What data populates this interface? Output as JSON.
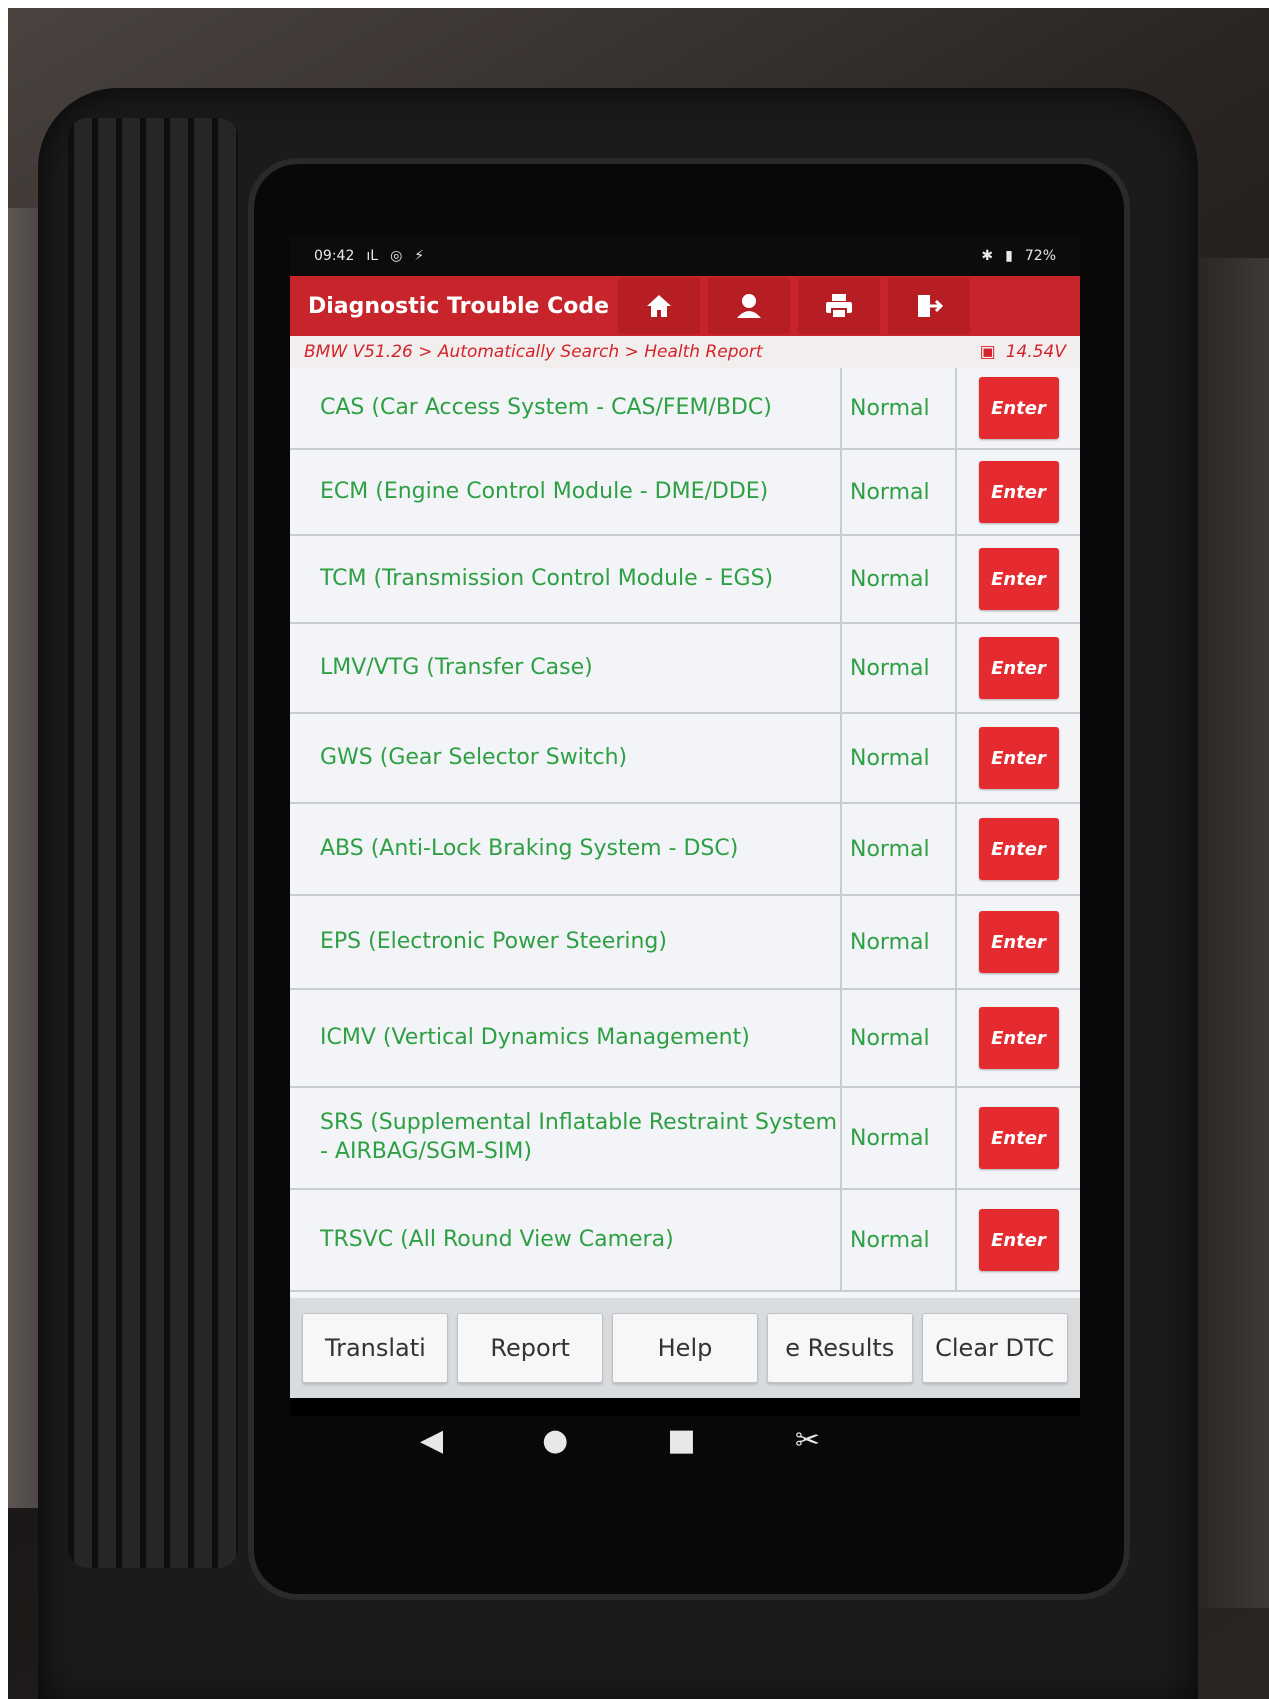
{
  "status_bar": {
    "time": "09:42",
    "carrier_mark": "ıL",
    "battery": "72%"
  },
  "header": {
    "title": "Diagnostic Trouble Code",
    "buttons": [
      {
        "name": "home",
        "icon": "home-icon"
      },
      {
        "name": "profile",
        "icon": "person-icon"
      },
      {
        "name": "print",
        "icon": "printer-icon"
      },
      {
        "name": "exit",
        "icon": "exit-icon"
      }
    ]
  },
  "breadcrumb": {
    "path": "BMW V51.26 > Automatically Search > Health Report",
    "voltage": "14.54V"
  },
  "systems": [
    {
      "name": "CAS (Car Access System - CAS/FEM/BDC)",
      "status": "Normal",
      "action": "Enter"
    },
    {
      "name": "ECM (Engine Control Module - DME/DDE)",
      "status": "Normal",
      "action": "Enter"
    },
    {
      "name": "TCM (Transmission Control Module - EGS)",
      "status": "Normal",
      "action": "Enter"
    },
    {
      "name": "LMV/VTG (Transfer Case)",
      "status": "Normal",
      "action": "Enter"
    },
    {
      "name": "GWS (Gear Selector Switch)",
      "status": "Normal",
      "action": "Enter"
    },
    {
      "name": "ABS (Anti-Lock Braking System - DSC)",
      "status": "Normal",
      "action": "Enter"
    },
    {
      "name": "EPS (Electronic Power Steering)",
      "status": "Normal",
      "action": "Enter"
    },
    {
      "name": "ICMV (Vertical Dynamics Management)",
      "status": "Normal",
      "action": "Enter"
    },
    {
      "name": "SRS (Supplemental Inflatable Restraint System - AIRBAG/SGM-SIM)",
      "status": "Normal",
      "action": "Enter"
    },
    {
      "name": "TRSVC (All Round View Camera)",
      "status": "Normal",
      "action": "Enter"
    }
  ],
  "bottom_buttons": [
    "Translati",
    "Report",
    "Help",
    "e Results",
    "Clear DTC"
  ],
  "nav_keys": [
    {
      "icon": "back-icon",
      "glyph": "◀"
    },
    {
      "icon": "home-circle-icon",
      "glyph": "●"
    },
    {
      "icon": "recents-icon",
      "glyph": "■"
    },
    {
      "icon": "screenshot-icon",
      "glyph": "✂"
    }
  ]
}
